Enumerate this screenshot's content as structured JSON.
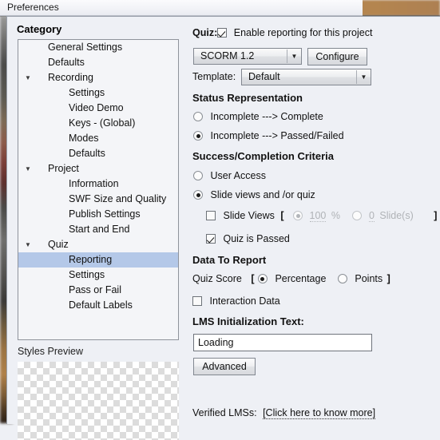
{
  "window": {
    "title": "Preferences"
  },
  "sidebar": {
    "header": "Category",
    "items": [
      {
        "label": "General Settings",
        "level": 1,
        "arrow": "",
        "selected": false
      },
      {
        "label": "Defaults",
        "level": 1,
        "arrow": "",
        "selected": false
      },
      {
        "label": "Recording",
        "level": 1,
        "arrow": "▼",
        "selected": false
      },
      {
        "label": "Settings",
        "level": 2,
        "arrow": "",
        "selected": false
      },
      {
        "label": "Video Demo",
        "level": 2,
        "arrow": "",
        "selected": false
      },
      {
        "label": "Keys - (Global)",
        "level": 2,
        "arrow": "",
        "selected": false
      },
      {
        "label": "Modes",
        "level": 2,
        "arrow": "",
        "selected": false
      },
      {
        "label": "Defaults",
        "level": 2,
        "arrow": "",
        "selected": false
      },
      {
        "label": "Project",
        "level": 1,
        "arrow": "▼",
        "selected": false
      },
      {
        "label": "Information",
        "level": 2,
        "arrow": "",
        "selected": false
      },
      {
        "label": "SWF Size and Quality",
        "level": 2,
        "arrow": "",
        "selected": false
      },
      {
        "label": "Publish Settings",
        "level": 2,
        "arrow": "",
        "selected": false
      },
      {
        "label": "Start and End",
        "level": 2,
        "arrow": "",
        "selected": false
      },
      {
        "label": "Quiz",
        "level": 1,
        "arrow": "▼",
        "selected": false
      },
      {
        "label": "Reporting",
        "level": 2,
        "arrow": "",
        "selected": true
      },
      {
        "label": "Settings",
        "level": 2,
        "arrow": "",
        "selected": false
      },
      {
        "label": "Pass or Fail",
        "level": 2,
        "arrow": "",
        "selected": false
      },
      {
        "label": "Default Labels",
        "level": 2,
        "arrow": "",
        "selected": false
      }
    ],
    "styles_preview_label": "Styles Preview"
  },
  "panel": {
    "quiz_label": "Quiz:",
    "enable_reporting_label": "Enable reporting for this project",
    "enable_reporting_checked": true,
    "lms_select_value": "SCORM 1.2",
    "configure_button": "Configure",
    "template_label": "Template:",
    "template_select_value": "Default",
    "status_representation_heading": "Status Representation",
    "status_option_1": "Incomplete ---> Complete",
    "status_option_2": "Incomplete ---> Passed/Failed",
    "status_selected_index": 1,
    "criteria_heading": "Success/Completion Criteria",
    "criteria_option_1": "User Access",
    "criteria_option_2": "Slide views and /or quiz",
    "criteria_selected_index": 1,
    "slide_views_label": "Slide Views",
    "slide_views_checked": false,
    "bracket_open": "[",
    "bracket_close": "]",
    "percent_value": "100",
    "percent_unit": "%",
    "percent_selected": true,
    "slides_value": "0",
    "slides_unit": "Slide(s)",
    "slides_selected": false,
    "quiz_is_passed_label": "Quiz is Passed",
    "quiz_is_passed_checked": true,
    "data_to_report_heading": "Data To Report",
    "quiz_score_label": "Quiz Score",
    "percentage_option": "Percentage",
    "points_option": "Points",
    "quiz_score_selected_index": 0,
    "interaction_data_label": "Interaction Data",
    "interaction_data_checked": false,
    "lms_init_heading": "LMS Initialization Text:",
    "lms_init_value": "Loading",
    "advanced_button": "Advanced",
    "verified_lms_label": "Verified LMSs:",
    "verified_lms_link": "[Click here to know more]"
  },
  "colors": {
    "selection": "#b4c8e8",
    "panel_bg": "#eef0f5",
    "tree_bg": "#f4f5f8",
    "border": "#8f939b",
    "disabled_text": "#b0b3b7"
  },
  "icons": {
    "expand_arrow": "▼",
    "dropdown_arrow": "▼"
  }
}
